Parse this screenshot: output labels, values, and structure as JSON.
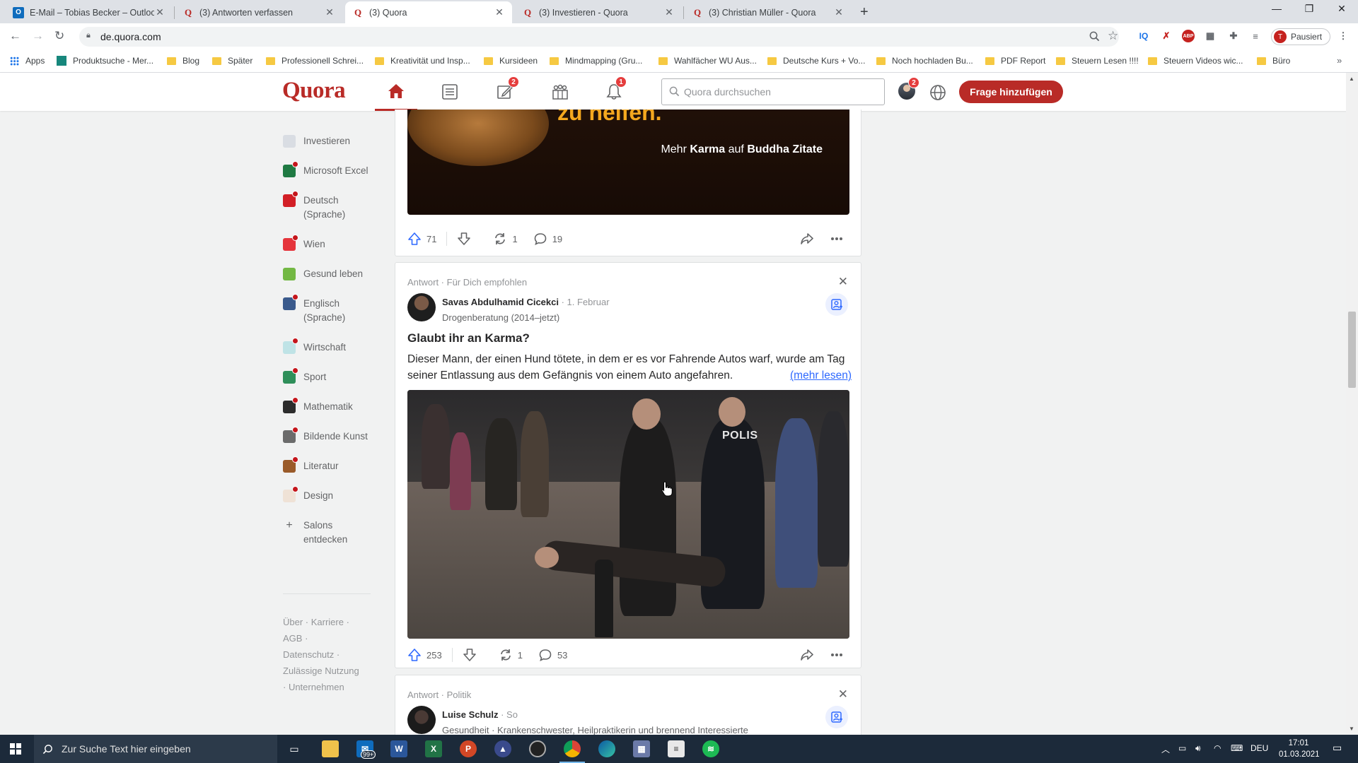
{
  "browser": {
    "tabs": [
      {
        "title": "E-Mail – Tobias Becker – Outlook",
        "favicon": "outlook-icon"
      },
      {
        "title": "(3) Antworten verfassen",
        "favicon": "quora-icon"
      },
      {
        "title": "(3) Quora",
        "favicon": "quora-icon",
        "active": true
      },
      {
        "title": "(3) Investieren - Quora",
        "favicon": "quora-icon"
      },
      {
        "title": "(3) Christian Müller - Quora",
        "favicon": "quora-icon"
      }
    ],
    "url": "de.quora.com",
    "profile_label": "Pausiert",
    "profile_initial": "T",
    "bookmarks": [
      "Apps",
      "Produktsuche - Mer...",
      "Blog",
      "Später",
      "Professionell Schrei...",
      "Kreativität und Insp...",
      "Kursideen",
      "Mindmapping  (Gru...",
      "Wahlfächer WU Aus...",
      "Deutsche Kurs + Vo...",
      "Noch hochladen Bu...",
      "PDF Report",
      "Steuern Lesen !!!!",
      "Steuern Videos wic...",
      "Büro"
    ]
  },
  "quora": {
    "logo": "Quora",
    "badges": {
      "write": "2",
      "notifications": "1",
      "avatar": "2"
    },
    "search_placeholder": "Quora durchsuchen",
    "add_question": "Frage hinzufügen",
    "accent": "#b92b27"
  },
  "sidebar": {
    "items": [
      {
        "label": "Investieren",
        "color": "#d9dde3",
        "dot": false
      },
      {
        "label": "Microsoft Excel",
        "color": "#1f7a43",
        "dot": true
      },
      {
        "label": "Deutsch (Sprache)",
        "color": "#d21f26",
        "dot": true
      },
      {
        "label": "Wien",
        "color": "#e5343b",
        "dot": true
      },
      {
        "label": "Gesund leben",
        "color": "#73b844",
        "dot": false
      },
      {
        "label": "Englisch (Sprache)",
        "color": "#3a5a8c",
        "dot": true
      },
      {
        "label": "Wirtschaft",
        "color": "#bfe3e6",
        "dot": true
      },
      {
        "label": "Sport",
        "color": "#2f8f5a",
        "dot": true
      },
      {
        "label": "Mathematik",
        "color": "#2c2c2c",
        "dot": true
      },
      {
        "label": "Bildende Kunst",
        "color": "#6b6b6b",
        "dot": true
      },
      {
        "label": "Literatur",
        "color": "#9a5b2a",
        "dot": true
      },
      {
        "label": "Design",
        "color": "#efe2d6",
        "dot": true
      }
    ],
    "discover": "Salons entdecken",
    "footer": "Über · Karriere · AGB · Datenschutz · Zulässige Nutzung · Unternehmen"
  },
  "feed": {
    "post1": {
      "image_caption_top": "zu helfen.",
      "image_caption_prefix": "Mehr",
      "image_caption_karma": "Karma",
      "image_caption_mid": "auf",
      "image_caption_brand": "Buddha Zitate",
      "upvotes": "71",
      "shares": "1",
      "comments": "19"
    },
    "post2": {
      "meta": "Antwort · Für Dich empfohlen",
      "author": "Savas Abdulhamid Cicekci",
      "date": "· 1. Februar",
      "credential": "Drogenberatung (2014–jetzt)",
      "question": "Glaubt ihr an Karma?",
      "text": "Dieser Mann, der einen Hund tötete, in dem er es vor Fahrende Autos warf, wurde am Tag seiner Entlassung aus dem Gefängnis von einem Auto angefahren.",
      "more": "(mehr lesen)",
      "video_label": "POLIS",
      "upvotes": "253",
      "shares": "1",
      "comments": "53"
    },
    "post3": {
      "meta": "Antwort · Politik",
      "author": "Luise Schulz",
      "date": "· So",
      "credential": "Gesundheit · Krankenschwester, Heilpraktikerin und brennend Interessierte"
    }
  },
  "taskbar": {
    "search_placeholder": "Zur Suche Text hier eingeben",
    "mail_badge": "99+",
    "language": "DEU",
    "time": "17:01",
    "date": "01.03.2021"
  }
}
